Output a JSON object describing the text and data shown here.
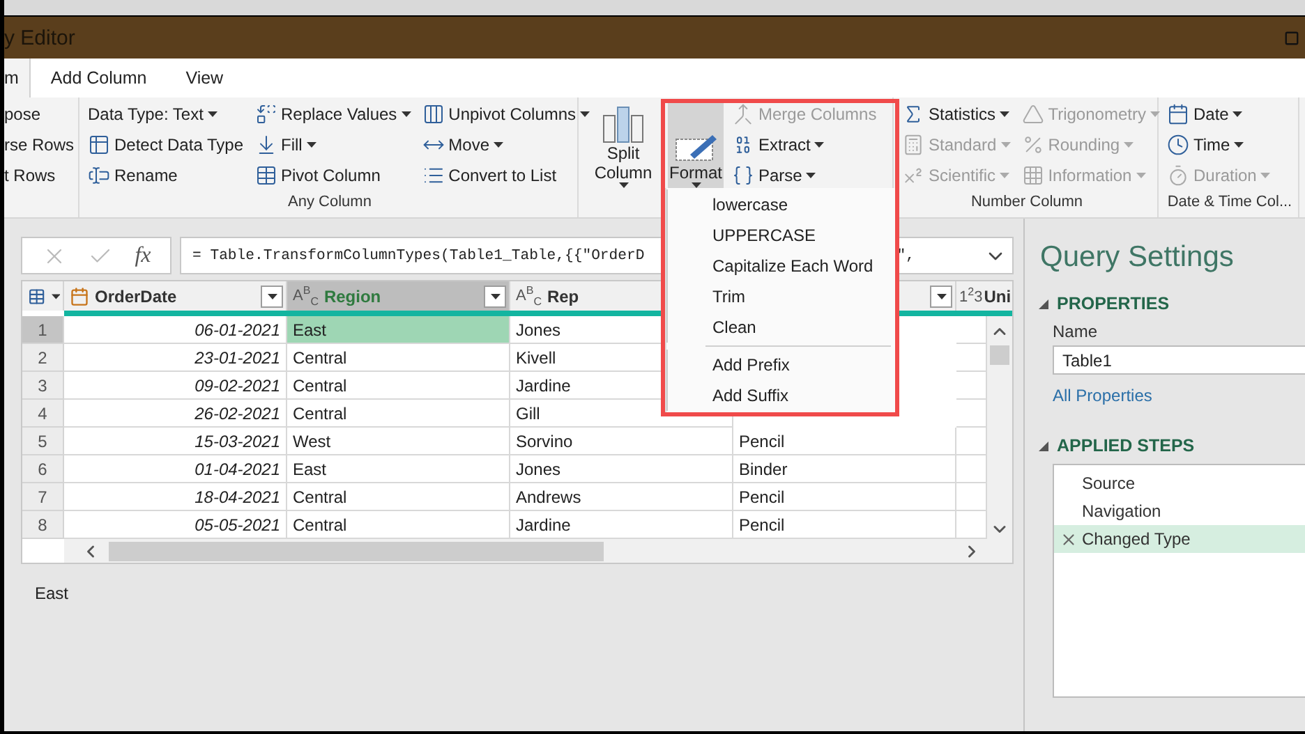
{
  "title_bar": {
    "title": "y Editor"
  },
  "tabs": [
    {
      "label": "m",
      "selected": true
    },
    {
      "label": "Add Column",
      "selected": false
    },
    {
      "label": "View",
      "selected": false
    }
  ],
  "ribbon": {
    "groups": [
      {
        "cut": true,
        "columns": [
          {
            "kind": "stack",
            "items": [
              {
                "label": "pose",
                "dropdown": false,
                "disabled": false
              },
              {
                "label": "rse Rows",
                "dropdown": false,
                "disabled": false
              },
              {
                "label": "t Rows",
                "dropdown": false,
                "disabled": false
              }
            ]
          }
        ]
      },
      {
        "cut": false,
        "label": "Any Column",
        "columns": [
          {
            "kind": "stack",
            "items": [
              {
                "label": "Data Type: Text",
                "dropdown": true,
                "disabled": false
              },
              {
                "label": "Detect Data Type",
                "dropdown": false,
                "disabled": false
              },
              {
                "label": "Rename",
                "dropdown": false,
                "disabled": false
              }
            ]
          },
          {
            "kind": "stack",
            "items": [
              {
                "label": "Replace Values",
                "dropdown": true,
                "disabled": false
              },
              {
                "label": "Fill",
                "dropdown": true,
                "disabled": false
              },
              {
                "label": "Pivot Column",
                "dropdown": false,
                "disabled": false
              }
            ]
          },
          {
            "kind": "stack",
            "items": [
              {
                "label": "Unpivot Columns",
                "dropdown": true,
                "disabled": false
              },
              {
                "label": "Move",
                "dropdown": true,
                "disabled": false
              },
              {
                "label": "Convert to List",
                "dropdown": false,
                "disabled": false
              }
            ]
          }
        ]
      },
      {
        "cut": false,
        "columns": [
          {
            "kind": "big",
            "label": "Split Column",
            "dropdown": true,
            "selected": false
          },
          {
            "kind": "big",
            "label": "Format",
            "dropdown": true,
            "selected": true
          },
          {
            "kind": "stack",
            "items": [
              {
                "label": "Merge Columns",
                "dropdown": false,
                "disabled": true
              },
              {
                "label": "Extract",
                "dropdown": true,
                "disabled": false
              },
              {
                "label": "Parse",
                "dropdown": true,
                "disabled": false
              }
            ]
          }
        ]
      },
      {
        "cut": false,
        "label": "Number Column",
        "columns": [
          {
            "kind": "stack",
            "items": [
              {
                "label": "Statistics",
                "dropdown": true,
                "disabled": false
              },
              {
                "label": "Standard",
                "dropdown": true,
                "disabled": true
              },
              {
                "label": "Scientific",
                "dropdown": true,
                "disabled": true
              }
            ]
          },
          {
            "kind": "stack",
            "items": [
              {
                "label": "Trigonometry",
                "dropdown": true,
                "disabled": true
              },
              {
                "label": "Rounding",
                "dropdown": true,
                "disabled": true
              },
              {
                "label": "Information",
                "dropdown": true,
                "disabled": true
              }
            ]
          }
        ]
      },
      {
        "cut": false,
        "label": "Date & Time Col...",
        "columns": [
          {
            "kind": "stack",
            "items": [
              {
                "label": "Date",
                "dropdown": true,
                "disabled": false
              },
              {
                "label": "Time",
                "dropdown": true,
                "disabled": false
              },
              {
                "label": "Duration",
                "dropdown": true,
                "disabled": true
              }
            ]
          }
        ]
      }
    ]
  },
  "format_menu": {
    "groups": [
      [
        "lowercase",
        "UPPERCASE",
        "Capitalize Each Word",
        "Trim",
        "Clean"
      ],
      [
        "Add Prefix",
        "Add Suffix"
      ]
    ]
  },
  "formula_bar": {
    "function_label": "fx",
    "formula": "= Table.TransformColumnTypes(Table1_Table,{{\"OrderD",
    "formula_tail": "\","
  },
  "table": {
    "columns": [
      {
        "label": "OrderDate",
        "kind": "date",
        "filter": true,
        "selected": false
      },
      {
        "label": "Region",
        "kind": "text",
        "type_glyph": "A$^{B}$$_{C}$",
        "filter": true,
        "selected": true
      },
      {
        "label": "Rep",
        "kind": "text",
        "type_glyph": "A$^{B}$$_{C}$",
        "filter": false,
        "selected": false
      },
      {
        "kind": "covered",
        "filter": true,
        "selected": false
      },
      {
        "label": "Uni",
        "kind": "number",
        "type_glyph": "1$^{2}$3",
        "filter": false,
        "selected": false
      }
    ],
    "rows": [
      {
        "number": "1",
        "selected": true,
        "cells": [
          "06-01-2021",
          "East",
          "Jones"
        ]
      },
      {
        "number": "2",
        "selected": false,
        "cells": [
          "23-01-2021",
          "Central",
          "Kivell"
        ]
      },
      {
        "number": "3",
        "selected": false,
        "cells": [
          "09-02-2021",
          "Central",
          "Jardine"
        ]
      },
      {
        "number": "4",
        "selected": false,
        "cells": [
          "26-02-2021",
          "Central",
          "Gill"
        ]
      },
      {
        "number": "5",
        "selected": false,
        "cells": [
          "15-03-2021",
          "West",
          "Sorvino",
          "Pencil"
        ]
      },
      {
        "number": "6",
        "selected": false,
        "cells": [
          "01-04-2021",
          "East",
          "Jones",
          "Binder"
        ]
      },
      {
        "number": "7",
        "selected": false,
        "cells": [
          "18-04-2021",
          "Central",
          "Andrews",
          "Pencil"
        ]
      },
      {
        "number": "8",
        "selected": false,
        "cells": [
          "05-05-2021",
          "Central",
          "Jardine",
          "Pencil"
        ]
      }
    ]
  },
  "preview": {
    "value": "East"
  },
  "query_settings": {
    "title": "Query Settings",
    "properties": {
      "heading": "PROPERTIES",
      "expanded": true,
      "name_label": "Name",
      "name_value": "Table1",
      "link": "All Properties"
    },
    "applied_steps": {
      "heading": "APPLIED STEPS",
      "expanded": true,
      "steps": [
        {
          "label": "Source",
          "selected": false
        },
        {
          "label": "Navigation",
          "selected": false
        },
        {
          "label": "Changed Type",
          "selected": true
        }
      ]
    }
  }
}
